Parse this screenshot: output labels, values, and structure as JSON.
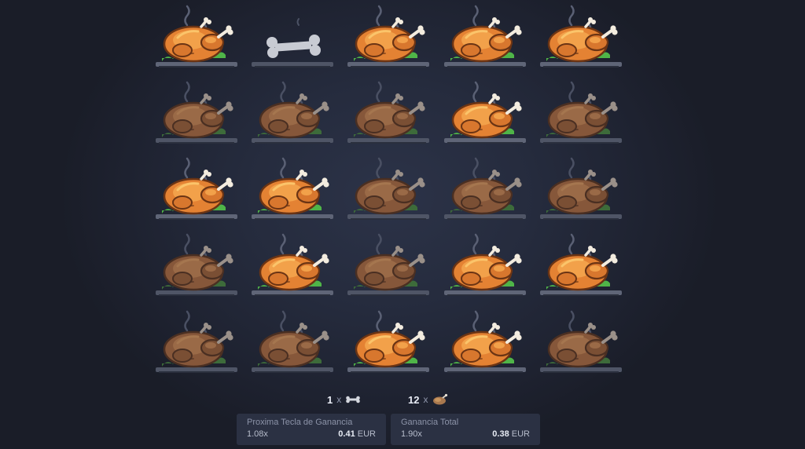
{
  "board": {
    "columns": 5,
    "rows": 5,
    "tiles": [
      {
        "item": "chicken",
        "state": "revealed"
      },
      {
        "item": "bone",
        "state": "revealed"
      },
      {
        "item": "chicken",
        "state": "revealed"
      },
      {
        "item": "chicken",
        "state": "revealed"
      },
      {
        "item": "chicken",
        "state": "revealed"
      },
      {
        "item": "chicken",
        "state": "dimmed"
      },
      {
        "item": "chicken",
        "state": "dimmed"
      },
      {
        "item": "chicken",
        "state": "dimmed"
      },
      {
        "item": "chicken",
        "state": "revealed"
      },
      {
        "item": "chicken",
        "state": "dimmed"
      },
      {
        "item": "chicken",
        "state": "revealed"
      },
      {
        "item": "chicken",
        "state": "revealed"
      },
      {
        "item": "chicken",
        "state": "dimmed"
      },
      {
        "item": "chicken",
        "state": "dimmed"
      },
      {
        "item": "chicken",
        "state": "dimmed"
      },
      {
        "item": "chicken",
        "state": "dimmed"
      },
      {
        "item": "chicken",
        "state": "revealed"
      },
      {
        "item": "chicken",
        "state": "dimmed"
      },
      {
        "item": "chicken",
        "state": "revealed"
      },
      {
        "item": "chicken",
        "state": "revealed"
      },
      {
        "item": "chicken",
        "state": "dimmed"
      },
      {
        "item": "chicken",
        "state": "dimmed"
      },
      {
        "item": "chicken",
        "state": "revealed"
      },
      {
        "item": "chicken",
        "state": "revealed"
      },
      {
        "item": "chicken",
        "state": "dimmed"
      }
    ]
  },
  "counters": {
    "bones": {
      "count": "1",
      "times": "x",
      "icon": "bone-icon"
    },
    "chickens": {
      "count": "12",
      "times": "x",
      "icon": "chicken-icon"
    }
  },
  "next_win": {
    "title": "Proxima Tecla de Ganancia",
    "multiplier": "1.08x",
    "amount": "0.41",
    "currency": "EUR"
  },
  "total_win": {
    "title": "Ganancia Total",
    "multiplier": "1.90x",
    "amount": "0.38",
    "currency": "EUR"
  },
  "colors": {
    "background": "#252b3d",
    "panel": "#2b3143",
    "chicken_skin": "#e8863a",
    "chicken_dim": "#8b5a3c",
    "lettuce": "#4fb548",
    "plate": "#5b6172",
    "bone": "#c9ccd4"
  }
}
